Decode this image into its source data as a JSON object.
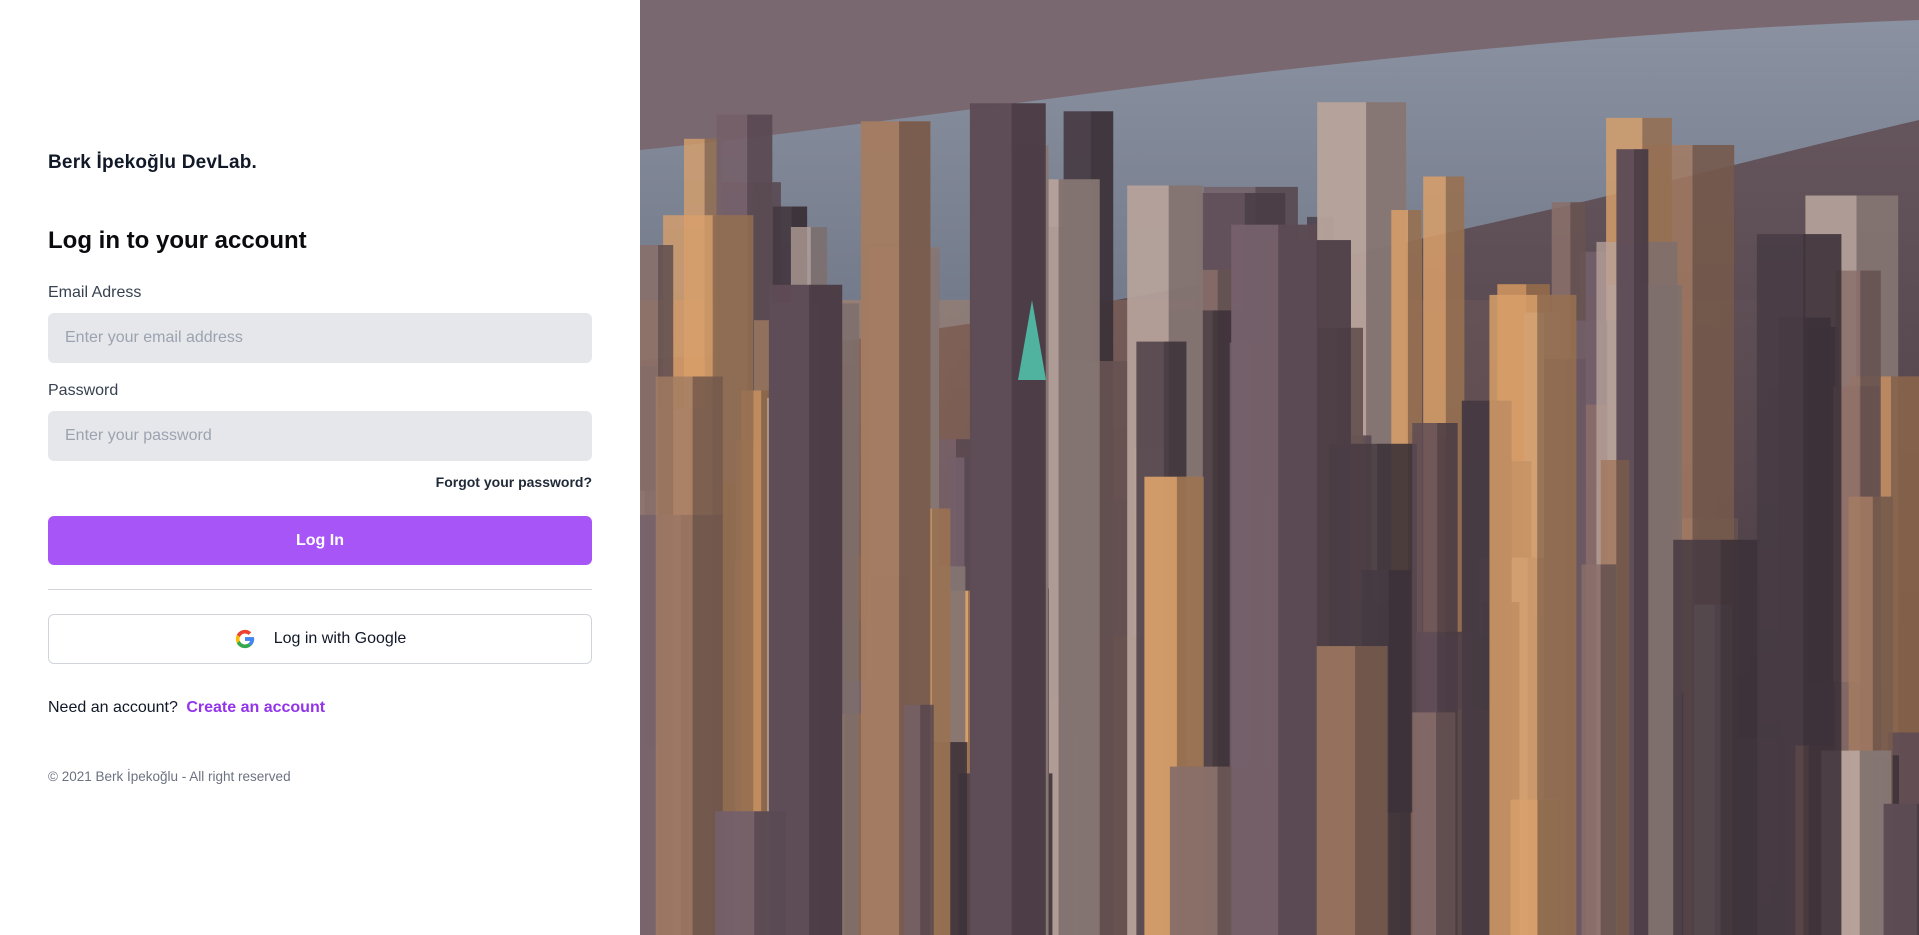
{
  "brand": {
    "name": "Berk İpekoğlu DevLab."
  },
  "form": {
    "heading": "Log in to your account",
    "email": {
      "label": "Email Adress",
      "placeholder": "Enter your email address",
      "value": ""
    },
    "password": {
      "label": "Password",
      "placeholder": "Enter your password",
      "value": ""
    },
    "forgot_label": "Forgot your password?",
    "login_label": "Log In",
    "google_label": "Log in with Google",
    "signup_prompt": "Need an account?",
    "signup_link": "Create an account"
  },
  "footer": {
    "text": "© 2021 Berk İpekoğlu - All right reserved"
  },
  "hero": {
    "image": "aerial-city-skyline-photo"
  },
  "colors": {
    "accent": "#a855f7",
    "accent_link": "#9333ea",
    "input_bg": "#e5e7eb",
    "google_blue": "#4285F4",
    "google_red": "#EA4335",
    "google_yellow": "#FBBC05",
    "google_green": "#34A853"
  }
}
